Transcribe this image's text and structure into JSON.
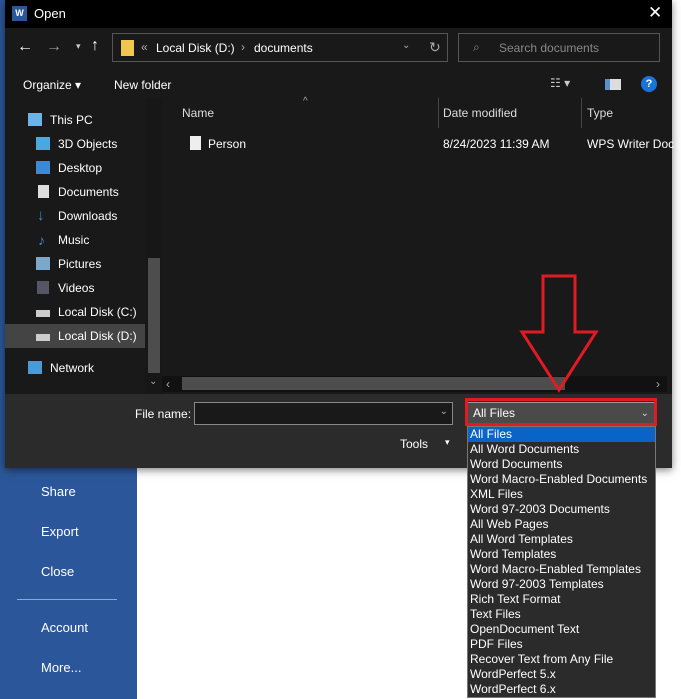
{
  "backstage": {
    "items": [
      "Share",
      "Export",
      "Close",
      "Account",
      "More..."
    ]
  },
  "dialog": {
    "title": "Open",
    "address": {
      "prefix": "«",
      "crumbs": [
        "Local Disk (D:)",
        "documents"
      ]
    },
    "search_placeholder": "Search documents",
    "toolbar": {
      "organize": "Organize",
      "new_folder": "New folder"
    },
    "nav_items": [
      "This PC",
      "3D Objects",
      "Desktop",
      "Documents",
      "Downloads",
      "Music",
      "Pictures",
      "Videos",
      "Local Disk (C:)",
      "Local Disk (D:)",
      "Network"
    ],
    "columns": {
      "name": "Name",
      "date": "Date modified",
      "type": "Type"
    },
    "files": [
      {
        "name": "Person",
        "date": "8/24/2023 11:39 AM",
        "type": "WPS Writer Doc"
      }
    ],
    "file_name_label": "File name:",
    "file_name_value": "",
    "file_type_selected": "All Files",
    "tools": "Tools",
    "file_type_options": [
      "All Files",
      "All Word Documents",
      "Word Documents",
      "Word Macro-Enabled Documents",
      "XML Files",
      "Word 97-2003 Documents",
      "All Web Pages",
      "All Word Templates",
      "Word Templates",
      "Word Macro-Enabled Templates",
      "Word 97-2003 Templates",
      "Rich Text Format",
      "Text Files",
      "OpenDocument Text",
      "PDF Files",
      "Recover Text from Any File",
      "WordPerfect 5.x",
      "WordPerfect 6.x"
    ]
  },
  "colors": {
    "highlight": "#e01b24",
    "selection": "#0a64c8",
    "word_blue": "#2b579a"
  }
}
